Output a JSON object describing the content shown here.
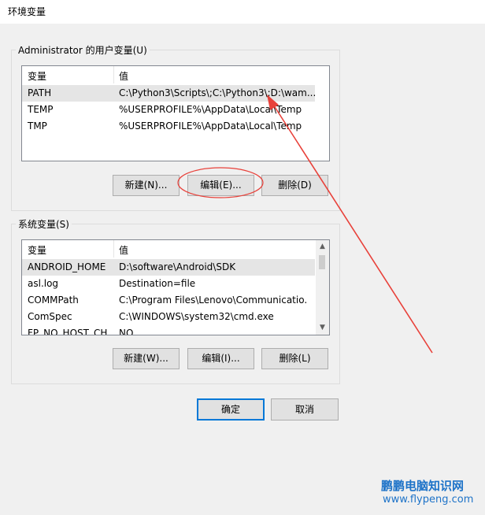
{
  "window": {
    "title": "环境变量"
  },
  "user_vars": {
    "label": "Administrator 的用户变量(U)",
    "headers": {
      "name": "变量",
      "value": "值"
    },
    "rows": [
      {
        "name": "PATH",
        "value": "C:\\Python3\\Scripts\\;C:\\Python3\\;D:\\wam..."
      },
      {
        "name": "TEMP",
        "value": "%USERPROFILE%\\AppData\\Local\\Temp"
      },
      {
        "name": "TMP",
        "value": "%USERPROFILE%\\AppData\\Local\\Temp"
      }
    ],
    "buttons": {
      "new": "新建(N)...",
      "edit": "编辑(E)...",
      "delete": "删除(D)"
    }
  },
  "system_vars": {
    "label": "系统变量(S)",
    "headers": {
      "name": "变量",
      "value": "值"
    },
    "rows": [
      {
        "name": "ANDROID_HOME",
        "value": "D:\\software\\Android\\SDK"
      },
      {
        "name": "asl.log",
        "value": "Destination=file"
      },
      {
        "name": "COMMPath",
        "value": "C:\\Program Files\\Lenovo\\Communicatio..."
      },
      {
        "name": "ComSpec",
        "value": "C:\\WINDOWS\\system32\\cmd.exe"
      },
      {
        "name": "FP_NO_HOST_CH...",
        "value": "NO"
      }
    ],
    "buttons": {
      "new": "新建(W)...",
      "edit": "编辑(I)...",
      "delete": "删除(L)"
    }
  },
  "dialog_buttons": {
    "ok": "确定",
    "cancel": "取消"
  },
  "watermark": {
    "line1": "鹏鹏电脑知识网",
    "line2": "www.flypeng.com"
  },
  "colors": {
    "annotation": "#e8413a",
    "selection": "#e5e5e5",
    "default_border": "#0078d7"
  },
  "icons": {
    "scroll_up": "▲",
    "scroll_down": "▼"
  }
}
